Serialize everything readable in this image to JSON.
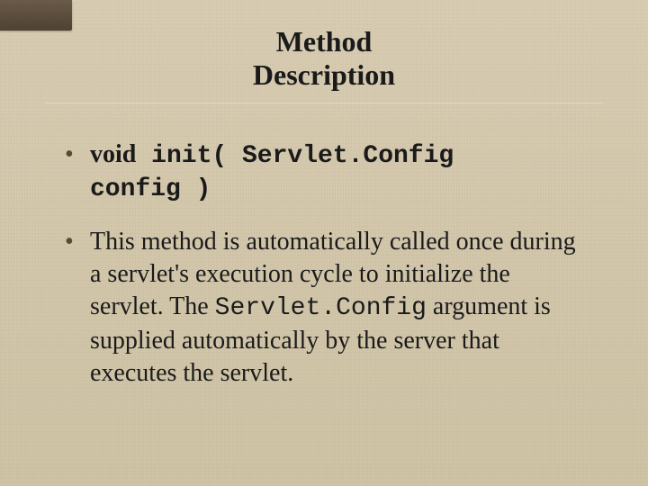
{
  "corner": {
    "semantic": "decorative-corner-tab"
  },
  "title": {
    "line1": "Method",
    "line2": "Description"
  },
  "bullets": {
    "b1": {
      "void_kw": "void",
      "sig_line1": " init( Servlet.Config",
      "sig_line2": "config )"
    },
    "b2": {
      "t1": "This method is automatically called once during a servlet's execution cycle to initialize the servlet. The ",
      "code": "Servlet.Config",
      "t2": " argument is supplied automatically by the server that executes the servlet."
    }
  }
}
